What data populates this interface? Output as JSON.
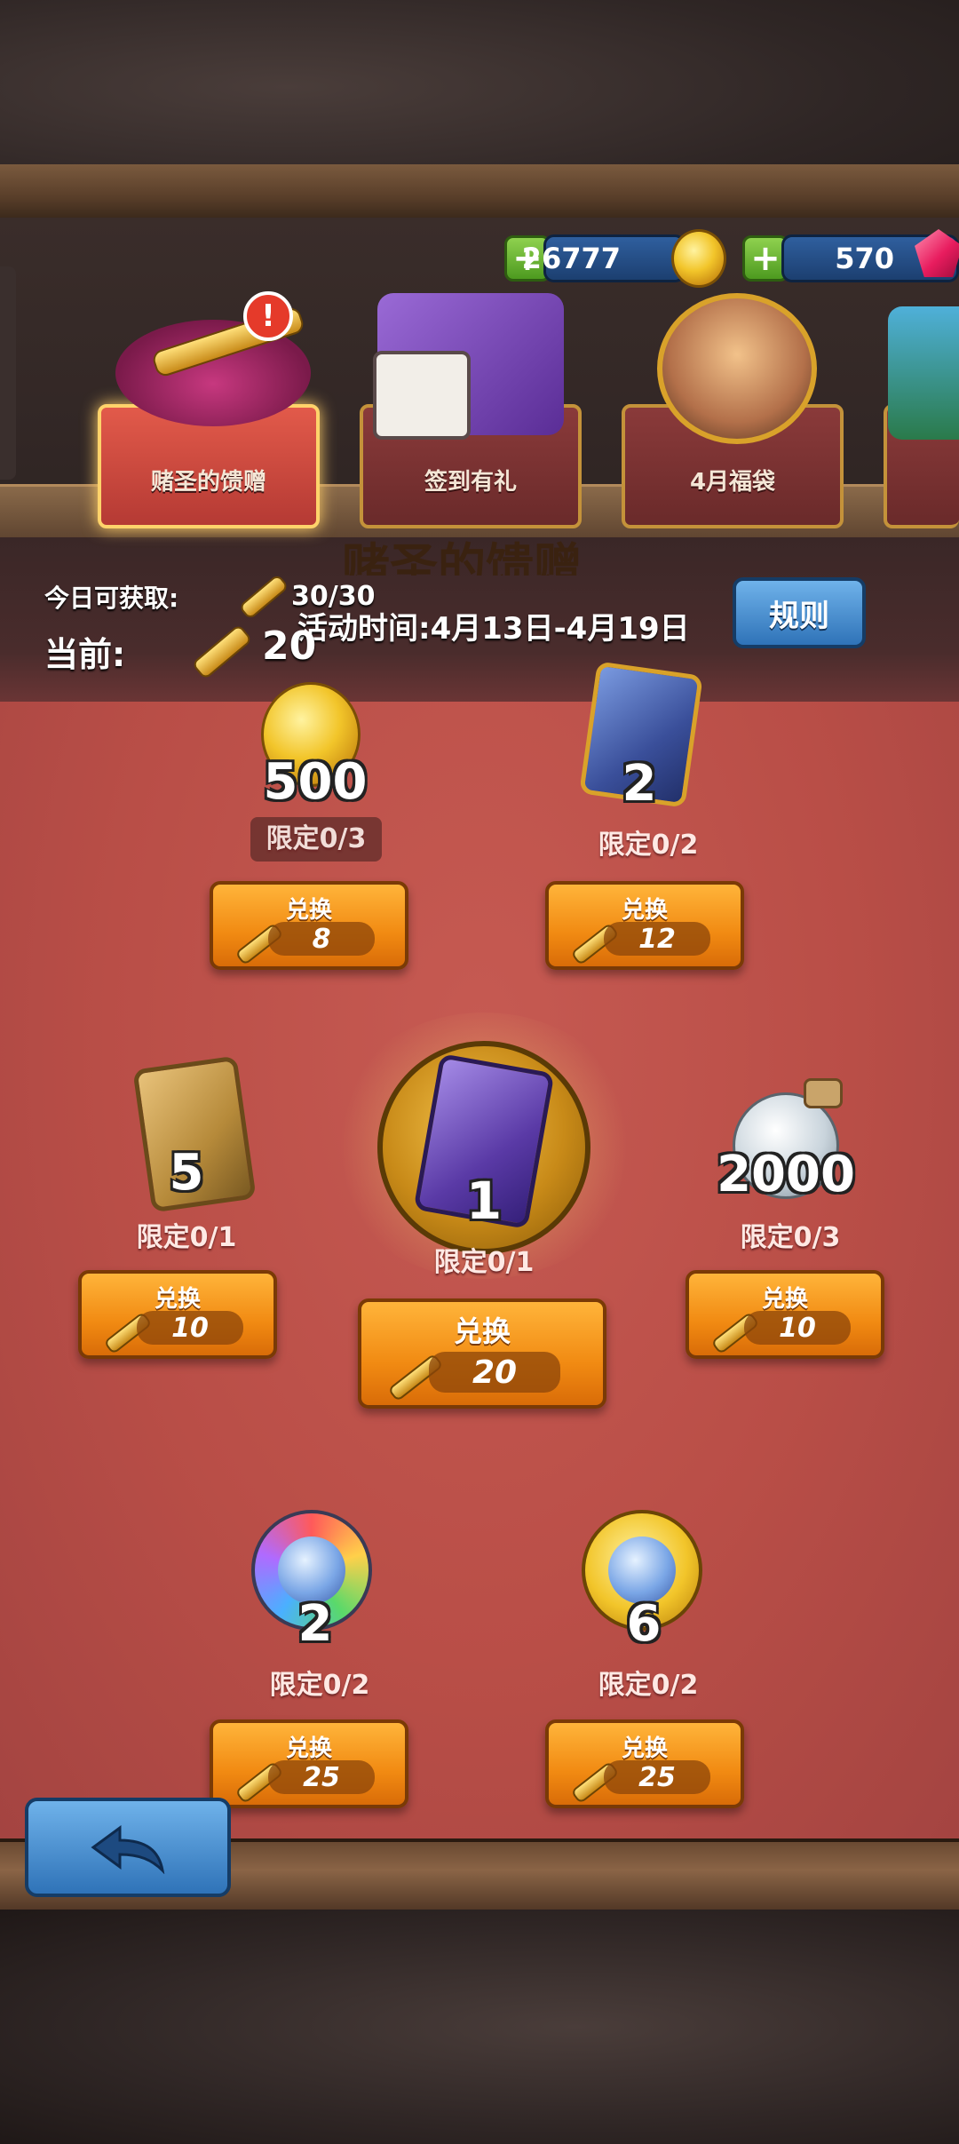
{
  "currency": {
    "gold": "26777",
    "gems": "570"
  },
  "tabs": [
    {
      "label": "赌圣的馈赠",
      "active": true
    },
    {
      "label": "签到有礼",
      "active": false
    },
    {
      "label": "4月福袋",
      "active": false
    }
  ],
  "header": {
    "title_partial": "赌圣的馈赠",
    "today_label": "今日可获取:",
    "today_value": "30/30",
    "current_label": "当前:",
    "current_value": "20",
    "event_time": "活动时间:4月13日-4月19日",
    "rules_button": "规则"
  },
  "items": [
    {
      "id": "gold",
      "amount": "500",
      "limit": "限定0/3",
      "button_label": "兑换",
      "cost": "8"
    },
    {
      "id": "card-blue",
      "amount": "2",
      "limit": "限定0/2",
      "button_label": "兑换",
      "cost": "12"
    },
    {
      "id": "card-gold",
      "amount": "5",
      "limit": "限定0/1",
      "button_label": "兑换",
      "cost": "10"
    },
    {
      "id": "card-purple",
      "amount": "1",
      "limit": "限定0/1",
      "button_label": "兑换",
      "cost": "20"
    },
    {
      "id": "potion",
      "amount": "2000",
      "limit": "限定0/3",
      "button_label": "兑换",
      "cost": "10"
    },
    {
      "id": "gem-rainbow",
      "amount": "2",
      "limit": "限定0/2",
      "button_label": "兑换",
      "cost": "25"
    },
    {
      "id": "gem-gold",
      "amount": "6",
      "limit": "限定0/2",
      "button_label": "兑换",
      "cost": "25"
    }
  ],
  "colors": {
    "panel": "#b94e47",
    "button": "#f18a12",
    "blue_button": "#2f73b8"
  }
}
